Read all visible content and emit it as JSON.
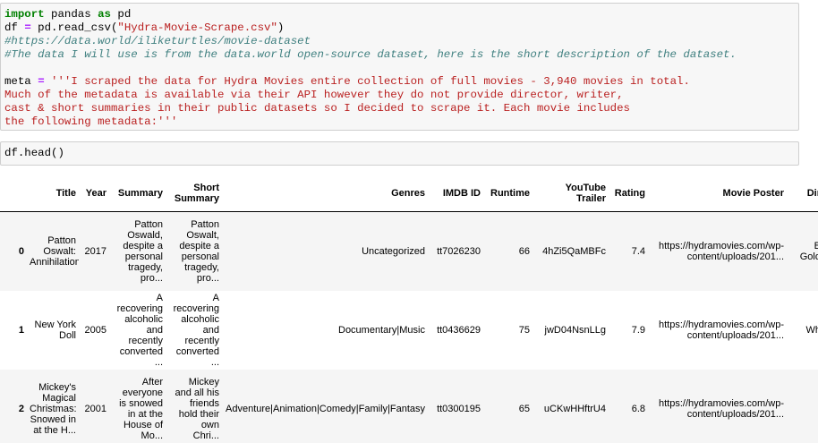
{
  "cell1": {
    "lines": [
      [
        {
          "t": "import",
          "c": "kw"
        },
        {
          "t": " pandas ",
          "c": "pl"
        },
        {
          "t": "as",
          "c": "kw"
        },
        {
          "t": " pd",
          "c": "pl"
        }
      ],
      [
        {
          "t": "df ",
          "c": "pl"
        },
        {
          "t": "=",
          "c": "op"
        },
        {
          "t": " pd.read_csv(",
          "c": "pl"
        },
        {
          "t": "\"Hydra-Movie-Scrape.csv\"",
          "c": "str"
        },
        {
          "t": ")",
          "c": "pl"
        }
      ],
      [
        {
          "t": "#https://data.world/iliketurtles/movie-dataset",
          "c": "cm"
        }
      ],
      [
        {
          "t": "#The data I will use is from the data.world open-source dataset, here is the short description of the dataset.",
          "c": "cm"
        }
      ],
      [
        {
          "t": " ",
          "c": "pl"
        }
      ],
      [
        {
          "t": "meta ",
          "c": "pl"
        },
        {
          "t": "=",
          "c": "op"
        },
        {
          "t": " '''I scraped the data for Hydra Movies entire collection of full movies - 3,940 movies in total.",
          "c": "str"
        }
      ],
      [
        {
          "t": "Much of the metadata is available via their API however they do not provide director, writer,",
          "c": "str"
        }
      ],
      [
        {
          "t": "cast & short summaries in their public datasets so I decided to scrape it. Each movie includes",
          "c": "str"
        }
      ],
      [
        {
          "t": "the following metadata:'''",
          "c": "str"
        }
      ]
    ]
  },
  "cell2": {
    "code": "df.head()"
  },
  "table": {
    "columns": [
      "",
      "Title",
      "Year",
      "Summary",
      "Short Summary",
      "Genres",
      "IMDB ID",
      "Runtime",
      "YouTube Trailer",
      "Rating",
      "Movie Poster",
      "Dir"
    ],
    "rows": [
      {
        "index": "0",
        "title": [
          "Patton",
          "Oswalt:",
          "Annihilation"
        ],
        "year": "2017",
        "summary": [
          "Patton",
          "Oswald,",
          "despite a",
          "personal",
          "tragedy,",
          "pro..."
        ],
        "short": [
          "Patton",
          "Oswalt,",
          "despite a",
          "personal",
          "tragedy,",
          "pro..."
        ],
        "genres": "Uncategorized",
        "imdb": "tt7026230",
        "runtime": "66",
        "trailer": "4hZi5QaMBFc",
        "rating": "7.4",
        "poster": [
          "https://hydramovies.com/wp-",
          "content/uploads/201..."
        ],
        "dir": [
          "B",
          "Gold"
        ]
      },
      {
        "index": "1",
        "title": [
          "New York",
          "Doll"
        ],
        "year": "2005",
        "summary": [
          "A",
          "recovering",
          "alcoholic",
          "and",
          "recently",
          "converted",
          "..."
        ],
        "short": [
          "A",
          "recovering",
          "alcoholic",
          "and",
          "recently",
          "converted",
          "..."
        ],
        "genres": "Documentary|Music",
        "imdb": "tt0436629",
        "runtime": "75",
        "trailer": "jwD04NsnLLg",
        "rating": "7.9",
        "poster": [
          "https://hydramovies.com/wp-",
          "content/uploads/201..."
        ],
        "dir": [
          "Wh"
        ]
      },
      {
        "index": "2",
        "title": [
          "Mickey's",
          "Magical",
          "Christmas:",
          "Snowed in",
          "at the H..."
        ],
        "year": "2001",
        "summary": [
          "After",
          "everyone",
          "is snowed",
          "in at the",
          "House of",
          "Mo..."
        ],
        "short": [
          "Mickey",
          "and all his",
          "friends",
          "hold their",
          "own",
          "Chri..."
        ],
        "genres": "Adventure|Animation|Comedy|Family|Fantasy",
        "imdb": "tt0300195",
        "runtime": "65",
        "trailer": "uCKwHHftrU4",
        "rating": "6.8",
        "poster": [
          "https://hydramovies.com/wp-",
          "content/uploads/201..."
        ],
        "dir": [
          ""
        ]
      }
    ]
  }
}
